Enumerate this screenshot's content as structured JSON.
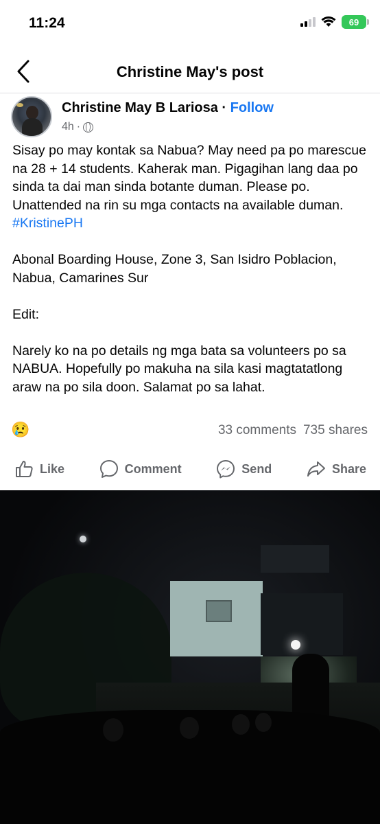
{
  "status_bar": {
    "time": "11:24",
    "battery": "69"
  },
  "header": {
    "title": "Christine May's post",
    "back_icon": "chevron-left-icon"
  },
  "post": {
    "author": "Christine May B Lariosa",
    "separator": "·",
    "follow_label": "Follow",
    "time": "4h",
    "dot": "·",
    "privacy_icon": "globe-icon",
    "body_text": "Sisay po may kontak sa Nabua? May need pa po marescue na 28 + 14 students. Kaherak man. Pigagihan lang daa po sinda ta dai man sinda botante duman. Please po. Unattended na rin su mga contacts na available duman.",
    "hashtag": "#KristinePH",
    "address": "Abonal Boarding House, Zone 3, San Isidro Poblacion, Nabua, Camarines Sur",
    "edit_label": "Edit:",
    "edit_text": "Narely ko na po details ng mga bata sa volunteers po sa NABUA. Hopefully po makuha na sila kasi magtatatlong araw na po sila doon. Salamat po sa lahat.",
    "reaction_emoji": "😢",
    "comments": "33 comments",
    "shares": "735 shares"
  },
  "actions": [
    {
      "label": "Like",
      "icon": "thumbs-up-icon"
    },
    {
      "label": "Comment",
      "icon": "comment-bubble-icon"
    },
    {
      "label": "Send",
      "icon": "messenger-icon"
    },
    {
      "label": "Share",
      "icon": "share-arrow-icon"
    }
  ],
  "colors": {
    "link": "#1877f2",
    "muted": "#65676b",
    "battery": "#34c759"
  }
}
